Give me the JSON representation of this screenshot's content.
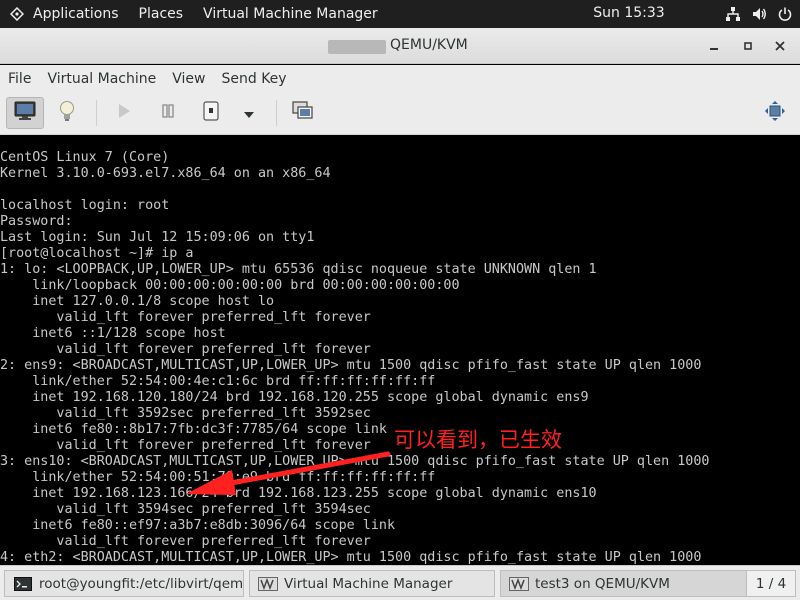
{
  "topbar": {
    "applications": "Applications",
    "places": "Places",
    "app_name": "Virtual Machine Manager",
    "clock": "Sun 15:33",
    "icons": [
      "network-icon",
      "volume-icon",
      "power-icon"
    ]
  },
  "window": {
    "title": "QEMU/KVM"
  },
  "menu": {
    "items": [
      "File",
      "Virtual Machine",
      "View",
      "Send Key"
    ]
  },
  "toolbar": {
    "icons": [
      "console-icon",
      "details-bulb-icon",
      "run-icon",
      "pause-icon",
      "shutdown-icon",
      "dropdown-arrow-icon",
      "snapshots-icon",
      "fullscreen-icon"
    ]
  },
  "console": {
    "lines": [
      "CentOS Linux 7 (Core)",
      "Kernel 3.10.0-693.el7.x86_64 on an x86_64",
      "",
      "localhost login: root",
      "Password:",
      "Last login: Sun Jul 12 15:09:06 on tty1",
      "[root@localhost ~]# ip a",
      "1: lo: <LOOPBACK,UP,LOWER_UP> mtu 65536 qdisc noqueue state UNKNOWN qlen 1",
      "    link/loopback 00:00:00:00:00:00 brd 00:00:00:00:00:00",
      "    inet 127.0.0.1/8 scope host lo",
      "       valid_lft forever preferred_lft forever",
      "    inet6 ::1/128 scope host",
      "       valid_lft forever preferred_lft forever",
      "2: ens9: <BROADCAST,MULTICAST,UP,LOWER_UP> mtu 1500 qdisc pfifo_fast state UP qlen 1000",
      "    link/ether 52:54:00:4e:c1:6c brd ff:ff:ff:ff:ff:ff",
      "    inet 192.168.120.180/24 brd 192.168.120.255 scope global dynamic ens9",
      "       valid_lft 3592sec preferred_lft 3592sec",
      "    inet6 fe80::8b17:7fb:dc3f:7785/64 scope link",
      "       valid_lft forever preferred_lft forever",
      "3: ens10: <BROADCAST,MULTICAST,UP,LOWER_UP> mtu 1500 qdisc pfifo_fast state UP qlen 1000",
      "    link/ether 52:54:00:51:79:e9 brd ff:ff:ff:ff:ff:ff",
      "    inet 192.168.123.166/24 brd 192.168.123.255 scope global dynamic ens10",
      "       valid_lft 3594sec preferred_lft 3594sec",
      "    inet6 fe80::ef97:a3b7:e8db:3096/64 scope link",
      "       valid_lft forever preferred_lft forever",
      "4: eth2: <BROADCAST,MULTICAST,UP,LOWER_UP> mtu 1500 qdisc pfifo_fast state UP qlen 1000"
    ],
    "annotation": "可以看到，已生效",
    "annotation_color": "#ff2020"
  },
  "taskbar": {
    "tasks": [
      "root@youngfit:/etc/libvirt/qemu/...",
      "Virtual Machine Manager",
      "test3 on QEMU/KVM"
    ],
    "workspace": "1 / 4"
  }
}
